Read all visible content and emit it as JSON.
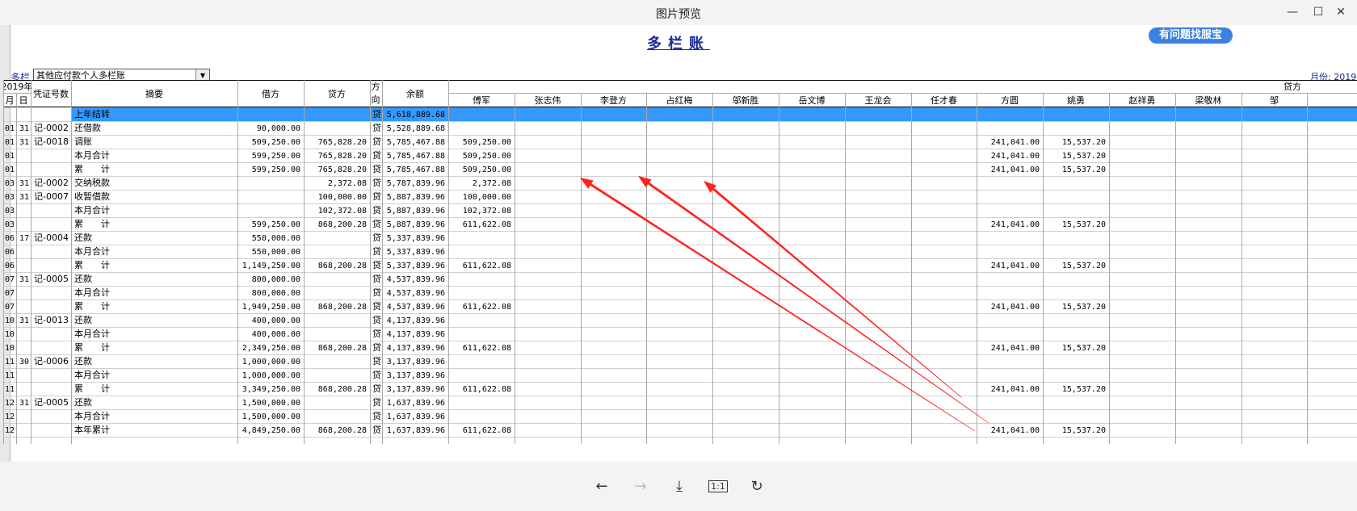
{
  "window": {
    "title": "图片预览",
    "minimize": "—",
    "maximize": "☐",
    "close": "✕"
  },
  "doc": {
    "title": "多栏账",
    "help_badge": "有问题找服宝",
    "left_label": "多栏",
    "selector_value": "其他应付款个人多栏账",
    "period_label": "月份: 2019"
  },
  "table": {
    "year_header": "2019年",
    "month_header": "月",
    "day_header": "日",
    "voucher_header": "凭证号数",
    "summary_header": "摘要",
    "debit_header": "借方",
    "credit_header": "贷方",
    "dir_header": "方向",
    "balance_header": "余额",
    "group_header": "贷方",
    "people": [
      "傅军",
      "张志伟",
      "李登方",
      "占红梅",
      "邬新胜",
      "岳文博",
      "王龙会",
      "任才春",
      "方圆",
      "姚勇",
      "赵祥勇",
      "梁敬林",
      "邹"
    ],
    "rows": [
      {
        "m": "",
        "d": "",
        "v": "",
        "s": "上年结转",
        "db": "",
        "cr": "",
        "dir": "贷",
        "bal": "5,618,889.68",
        "c1": "",
        "c9": "",
        "c10": "",
        "selected": true
      },
      {
        "m": "01",
        "d": "31",
        "v": "记-0002",
        "s": "还借款",
        "db": "90,000.00",
        "cr": "",
        "dir": "贷",
        "bal": "5,528,889.68",
        "c1": "",
        "c9": "",
        "c10": ""
      },
      {
        "m": "01",
        "d": "31",
        "v": "记-0018",
        "s": "调账",
        "db": "509,250.00",
        "cr": "765,828.20",
        "dir": "贷",
        "bal": "5,785,467.88",
        "c1": "509,250.00",
        "c9": "241,041.00",
        "c10": "15,537.20"
      },
      {
        "m": "01",
        "d": "",
        "v": "",
        "s": "本月合计",
        "db": "599,250.00",
        "cr": "765,828.20",
        "dir": "贷",
        "bal": "5,785,467.88",
        "c1": "509,250.00",
        "c9": "241,041.00",
        "c10": "15,537.20"
      },
      {
        "m": "01",
        "d": "",
        "v": "",
        "s": "累　　计",
        "db": "599,250.00",
        "cr": "765,828.20",
        "dir": "贷",
        "bal": "5,785,467.88",
        "c1": "509,250.00",
        "c9": "241,041.00",
        "c10": "15,537.20"
      },
      {
        "m": "03",
        "d": "31",
        "v": "记-0002",
        "s": "交纳税款",
        "db": "",
        "cr": "2,372.08",
        "dir": "贷",
        "bal": "5,787,839.96",
        "c1": "2,372.08",
        "c9": "",
        "c10": ""
      },
      {
        "m": "03",
        "d": "31",
        "v": "记-0007",
        "s": "收暂借款",
        "db": "",
        "cr": "100,000.00",
        "dir": "贷",
        "bal": "5,887,839.96",
        "c1": "100,000.00",
        "c9": "",
        "c10": ""
      },
      {
        "m": "03",
        "d": "",
        "v": "",
        "s": "本月合计",
        "db": "",
        "cr": "102,372.08",
        "dir": "贷",
        "bal": "5,887,839.96",
        "c1": "102,372.08",
        "c9": "",
        "c10": ""
      },
      {
        "m": "03",
        "d": "",
        "v": "",
        "s": "累　　计",
        "db": "599,250.00",
        "cr": "868,200.28",
        "dir": "贷",
        "bal": "5,887,839.96",
        "c1": "611,622.08",
        "c9": "241,041.00",
        "c10": "15,537.20"
      },
      {
        "m": "06",
        "d": "17",
        "v": "记-0004",
        "s": "还款",
        "db": "550,000.00",
        "cr": "",
        "dir": "贷",
        "bal": "5,337,839.96",
        "c1": "",
        "c9": "",
        "c10": ""
      },
      {
        "m": "06",
        "d": "",
        "v": "",
        "s": "本月合计",
        "db": "550,000.00",
        "cr": "",
        "dir": "贷",
        "bal": "5,337,839.96",
        "c1": "",
        "c9": "",
        "c10": ""
      },
      {
        "m": "06",
        "d": "",
        "v": "",
        "s": "累　　计",
        "db": "1,149,250.00",
        "cr": "868,200.28",
        "dir": "贷",
        "bal": "5,337,839.96",
        "c1": "611,622.08",
        "c9": "241,041.00",
        "c10": "15,537.20"
      },
      {
        "m": "07",
        "d": "31",
        "v": "记-0005",
        "s": "还款",
        "db": "800,000.00",
        "cr": "",
        "dir": "贷",
        "bal": "4,537,839.96",
        "c1": "",
        "c9": "",
        "c10": ""
      },
      {
        "m": "07",
        "d": "",
        "v": "",
        "s": "本月合计",
        "db": "800,000.00",
        "cr": "",
        "dir": "贷",
        "bal": "4,537,839.96",
        "c1": "",
        "c9": "",
        "c10": ""
      },
      {
        "m": "07",
        "d": "",
        "v": "",
        "s": "累　　计",
        "db": "1,949,250.00",
        "cr": "868,200.28",
        "dir": "贷",
        "bal": "4,537,839.96",
        "c1": "611,622.08",
        "c9": "241,041.00",
        "c10": "15,537.20"
      },
      {
        "m": "10",
        "d": "31",
        "v": "记-0013",
        "s": "还款",
        "db": "400,000.00",
        "cr": "",
        "dir": "贷",
        "bal": "4,137,839.96",
        "c1": "",
        "c9": "",
        "c10": ""
      },
      {
        "m": "10",
        "d": "",
        "v": "",
        "s": "本月合计",
        "db": "400,000.00",
        "cr": "",
        "dir": "贷",
        "bal": "4,137,839.96",
        "c1": "",
        "c9": "",
        "c10": ""
      },
      {
        "m": "10",
        "d": "",
        "v": "",
        "s": "累　　计",
        "db": "2,349,250.00",
        "cr": "868,200.28",
        "dir": "贷",
        "bal": "4,137,839.96",
        "c1": "611,622.08",
        "c9": "241,041.00",
        "c10": "15,537.20"
      },
      {
        "m": "11",
        "d": "30",
        "v": "记-0006",
        "s": "还款",
        "db": "1,000,000.00",
        "cr": "",
        "dir": "贷",
        "bal": "3,137,839.96",
        "c1": "",
        "c9": "",
        "c10": ""
      },
      {
        "m": "11",
        "d": "",
        "v": "",
        "s": "本月合计",
        "db": "1,000,000.00",
        "cr": "",
        "dir": "贷",
        "bal": "3,137,839.96",
        "c1": "",
        "c9": "",
        "c10": ""
      },
      {
        "m": "11",
        "d": "",
        "v": "",
        "s": "累　　计",
        "db": "3,349,250.00",
        "cr": "868,200.28",
        "dir": "贷",
        "bal": "3,137,839.96",
        "c1": "611,622.08",
        "c9": "241,041.00",
        "c10": "15,537.20"
      },
      {
        "m": "12",
        "d": "31",
        "v": "记-0005",
        "s": "还款",
        "db": "1,500,000.00",
        "cr": "",
        "dir": "贷",
        "bal": "1,637,839.96",
        "c1": "",
        "c9": "",
        "c10": ""
      },
      {
        "m": "12",
        "d": "",
        "v": "",
        "s": "本月合计",
        "db": "1,500,000.00",
        "cr": "",
        "dir": "贷",
        "bal": "1,637,839.96",
        "c1": "",
        "c9": "",
        "c10": ""
      },
      {
        "m": "12",
        "d": "",
        "v": "",
        "s": "本年累计",
        "db": "4,849,250.00",
        "cr": "868,200.28",
        "dir": "贷",
        "bal": "1,637,839.96",
        "c1": "611,622.08",
        "c9": "241,041.00",
        "c10": "15,537.20"
      }
    ]
  },
  "colors": {
    "selection": "#3399ff",
    "grid": "#a8a8a8",
    "header_text": "#000000",
    "title_blue": "#1a2a9c",
    "arrow_red": "#ff2222"
  },
  "toolbar": {
    "back_icon": "←",
    "forward_icon": "→",
    "download_icon": "⤓",
    "actual_size_icon": "1:1",
    "rotate_icon": "↻"
  }
}
